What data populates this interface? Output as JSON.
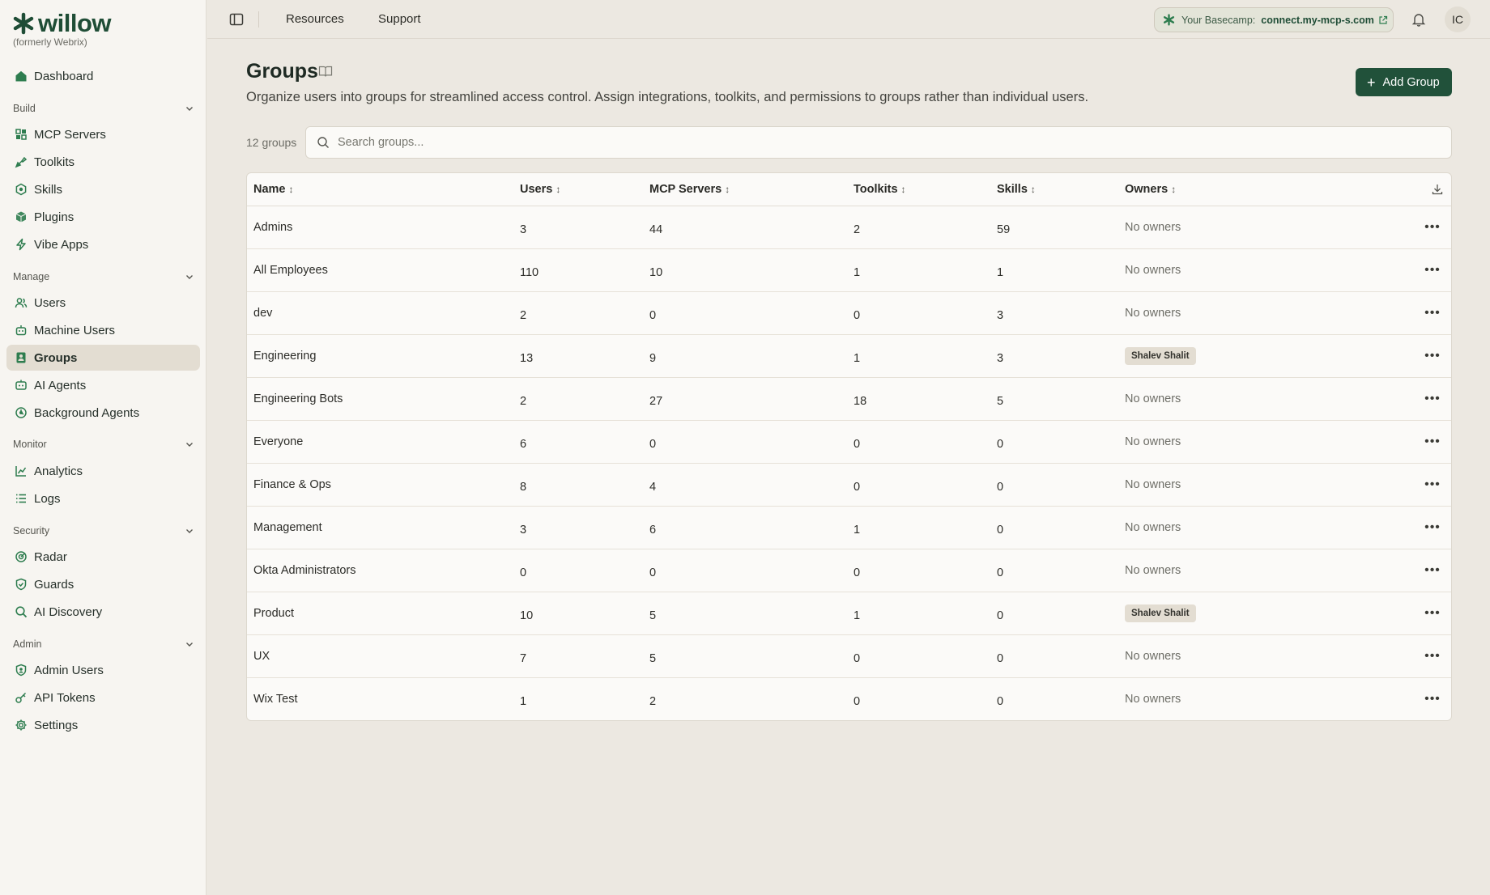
{
  "brand": {
    "name": "willow",
    "subtitle": "(formerly Webrix)"
  },
  "sidebar": {
    "top": [
      {
        "label": "Dashboard",
        "icon": "home-icon"
      }
    ],
    "sections": [
      {
        "title": "Build",
        "items": [
          {
            "label": "MCP Servers",
            "icon": "mcp-servers-icon"
          },
          {
            "label": "Toolkits",
            "icon": "toolkits-icon"
          },
          {
            "label": "Skills",
            "icon": "skills-icon"
          },
          {
            "label": "Plugins",
            "icon": "plugins-icon"
          },
          {
            "label": "Vibe Apps",
            "icon": "lightning-icon"
          }
        ]
      },
      {
        "title": "Manage",
        "items": [
          {
            "label": "Users",
            "icon": "users-icon"
          },
          {
            "label": "Machine Users",
            "icon": "robot-icon"
          },
          {
            "label": "Groups",
            "icon": "groups-icon",
            "active": true
          },
          {
            "label": "AI Agents",
            "icon": "ai-agent-icon"
          },
          {
            "label": "Background Agents",
            "icon": "background-agent-icon"
          }
        ]
      },
      {
        "title": "Monitor",
        "items": [
          {
            "label": "Analytics",
            "icon": "analytics-icon"
          },
          {
            "label": "Logs",
            "icon": "logs-icon"
          }
        ]
      },
      {
        "title": "Security",
        "items": [
          {
            "label": "Radar",
            "icon": "radar-icon"
          },
          {
            "label": "Guards",
            "icon": "shield-icon"
          },
          {
            "label": "AI Discovery",
            "icon": "discovery-icon"
          }
        ]
      },
      {
        "title": "Admin",
        "items": [
          {
            "label": "Admin Users",
            "icon": "admin-users-icon"
          },
          {
            "label": "API Tokens",
            "icon": "key-icon"
          },
          {
            "label": "Settings",
            "icon": "gear-icon"
          }
        ]
      }
    ]
  },
  "topbar": {
    "links": [
      "Resources",
      "Support"
    ],
    "basecamp_label": "Your Basecamp:",
    "basecamp_link": "connect.my-mcp-s.com",
    "avatar_initials": "IC"
  },
  "page": {
    "title": "Groups",
    "description": "Organize users into groups for streamlined access control. Assign integrations, toolkits, and permissions to groups rather than individual users.",
    "add_button": "Add Group",
    "count": "12 groups",
    "search_placeholder": "Search groups..."
  },
  "table": {
    "columns": [
      "Name",
      "Users",
      "MCP Servers",
      "Toolkits",
      "Skills",
      "Owners"
    ],
    "rows": [
      {
        "name": "Admins",
        "users": "3",
        "mcp": "44",
        "toolkits": "2",
        "skills": "59",
        "owners": "No owners",
        "owner_badge": false
      },
      {
        "name": "All Employees",
        "users": "110",
        "mcp": "10",
        "toolkits": "1",
        "skills": "1",
        "owners": "No owners",
        "owner_badge": false
      },
      {
        "name": "dev",
        "users": "2",
        "mcp": "0",
        "toolkits": "0",
        "skills": "3",
        "owners": "No owners",
        "owner_badge": false
      },
      {
        "name": "Engineering",
        "users": "13",
        "mcp": "9",
        "toolkits": "1",
        "skills": "3",
        "owners": "Shalev Shalit",
        "owner_badge": true
      },
      {
        "name": "Engineering Bots",
        "users": "2",
        "mcp": "27",
        "toolkits": "18",
        "skills": "5",
        "owners": "No owners",
        "owner_badge": false
      },
      {
        "name": "Everyone",
        "users": "6",
        "mcp": "0",
        "toolkits": "0",
        "skills": "0",
        "owners": "No owners",
        "owner_badge": false
      },
      {
        "name": "Finance & Ops",
        "users": "8",
        "mcp": "4",
        "toolkits": "0",
        "skills": "0",
        "owners": "No owners",
        "owner_badge": false
      },
      {
        "name": "Management",
        "users": "3",
        "mcp": "6",
        "toolkits": "1",
        "skills": "0",
        "owners": "No owners",
        "owner_badge": false
      },
      {
        "name": "Okta Administrators",
        "users": "0",
        "mcp": "0",
        "toolkits": "0",
        "skills": "0",
        "owners": "No owners",
        "owner_badge": false
      },
      {
        "name": "Product",
        "users": "10",
        "mcp": "5",
        "toolkits": "1",
        "skills": "0",
        "owners": "Shalev Shalit",
        "owner_badge": true
      },
      {
        "name": "UX",
        "users": "7",
        "mcp": "5",
        "toolkits": "0",
        "skills": "0",
        "owners": "No owners",
        "owner_badge": false
      },
      {
        "name": "Wix Test",
        "users": "1",
        "mcp": "2",
        "toolkits": "0",
        "skills": "0",
        "owners": "No owners",
        "owner_badge": false
      }
    ]
  },
  "colors": {
    "brand": "#1f4d36",
    "accent": "#21513a",
    "icon_green": "#2e7d4f",
    "active_bg": "#e3ddd2"
  }
}
